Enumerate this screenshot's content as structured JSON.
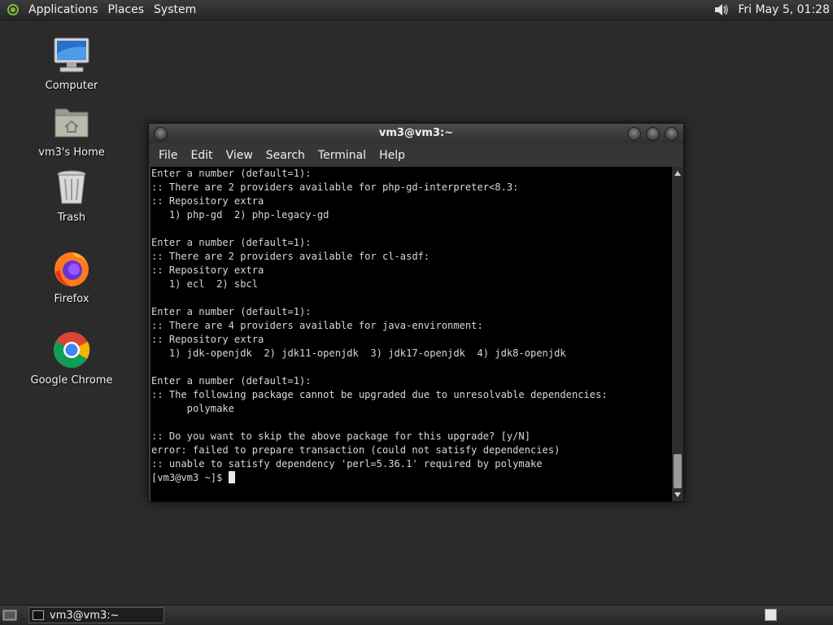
{
  "top_panel": {
    "menus": [
      "Applications",
      "Places",
      "System"
    ],
    "clock": "Fri May  5, 01:28"
  },
  "desktop": {
    "icons": [
      {
        "label": "Computer",
        "icon": "computer-icon"
      },
      {
        "label": "vm3's Home",
        "icon": "home-folder-icon"
      },
      {
        "label": "Trash",
        "icon": "trash-icon"
      },
      {
        "label": "Firefox",
        "icon": "firefox-icon"
      },
      {
        "label": "Google Chrome",
        "icon": "chrome-icon"
      }
    ]
  },
  "window": {
    "title": "vm3@vm3:~",
    "menus": [
      "File",
      "Edit",
      "View",
      "Search",
      "Terminal",
      "Help"
    ],
    "terminal_lines": [
      "Enter a number (default=1):",
      ":: There are 2 providers available for php-gd-interpreter<8.3:",
      ":: Repository extra",
      "   1) php-gd  2) php-legacy-gd",
      "",
      "Enter a number (default=1):",
      ":: There are 2 providers available for cl-asdf:",
      ":: Repository extra",
      "   1) ecl  2) sbcl",
      "",
      "Enter a number (default=1):",
      ":: There are 4 providers available for java-environment:",
      ":: Repository extra",
      "   1) jdk-openjdk  2) jdk11-openjdk  3) jdk17-openjdk  4) jdk8-openjdk",
      "",
      "Enter a number (default=1):",
      ":: The following package cannot be upgraded due to unresolvable dependencies:",
      "      polymake",
      "",
      ":: Do you want to skip the above package for this upgrade? [y/N]",
      "error: failed to prepare transaction (could not satisfy dependencies)",
      ":: unable to satisfy dependency 'perl=5.36.1' required by polymake"
    ],
    "prompt": "[vm3@vm3 ~]$ "
  },
  "bottom_panel": {
    "task_label": "vm3@vm3:~"
  }
}
